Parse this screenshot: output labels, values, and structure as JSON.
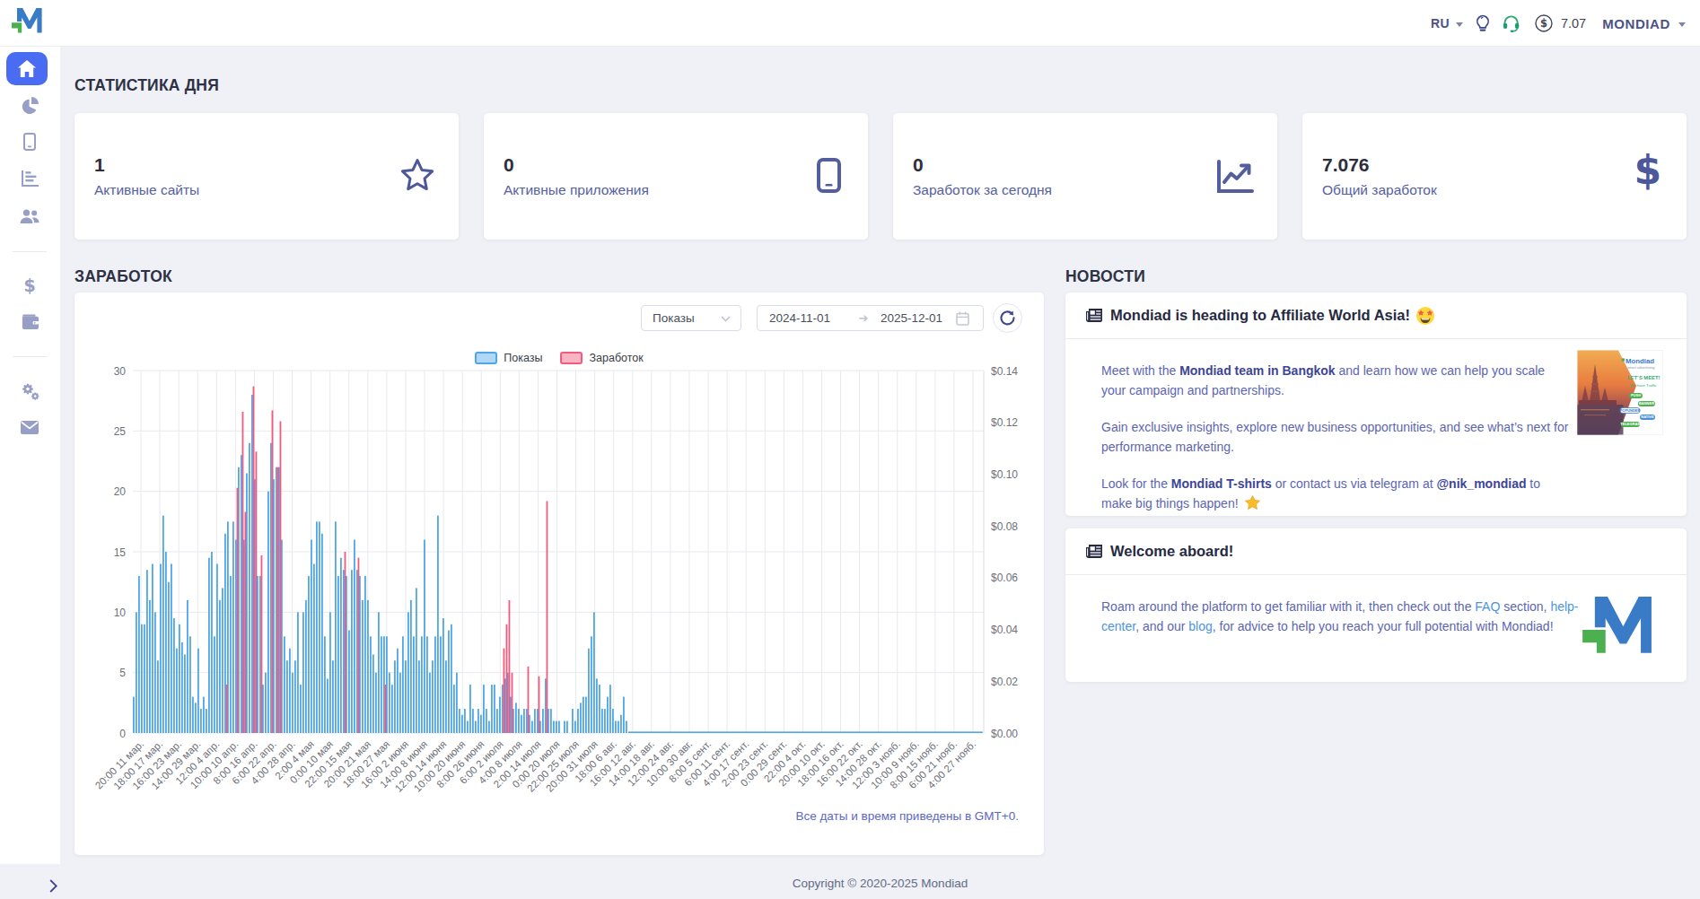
{
  "header": {
    "brand": "Mondiad",
    "lang": "RU",
    "balance": "7.07",
    "account": "MONDIAD"
  },
  "sidebar": {
    "items": [
      {
        "icon": "home",
        "active": true
      },
      {
        "icon": "pie-chart",
        "active": false
      },
      {
        "icon": "mobile",
        "active": false
      },
      {
        "icon": "bar-chart",
        "active": false
      },
      {
        "icon": "users",
        "active": false
      },
      {
        "icon": "dollar",
        "active": false
      },
      {
        "icon": "wallet",
        "active": false
      },
      {
        "icon": "gears",
        "active": false
      },
      {
        "icon": "envelope",
        "active": false
      }
    ]
  },
  "stats": {
    "title": "СТАТИСТИКА ДНЯ",
    "cards": [
      {
        "value": "1",
        "label": "Активные сайты",
        "icon": "star"
      },
      {
        "value": "0",
        "label": "Активные приложения",
        "icon": "mobile"
      },
      {
        "value": "0",
        "label": "Заработок за сегодня",
        "icon": "chart-line"
      },
      {
        "value": "7.076",
        "label": "Общий заработок",
        "icon": "dollar"
      }
    ]
  },
  "earnings": {
    "title": "ЗАРАБОТОК",
    "metric_select": "Показы",
    "date_from": "2024-11-01",
    "date_to": "2025-12-01",
    "gmt_note": "Все даты и время приведены в GMT+0."
  },
  "chart_data": {
    "type": "bar",
    "title": "",
    "x_labels": [
      "20:00 11 мар.",
      "18:00 17 мар.",
      "16:00 23 мар.",
      "14:00 29 мар.",
      "12:00 4 апр.",
      "10:00 10 апр.",
      "8:00 16 апр.",
      "6:00 22 апр.",
      "4:00 28 апр.",
      "2:00 4 мая",
      "0:00 10 мая",
      "22:00 15 мая",
      "20:00 21 мая",
      "18:00 27 мая",
      "16:00 2 июня",
      "14:00 8 июня",
      "12:00 14 июня",
      "10:00 20 июня",
      "8:00 26 июня",
      "6:00 2 июля",
      "4:00 8 июля",
      "2:00 14 июля",
      "0:00 20 июля",
      "22:00 25 июля",
      "20:00 31 июля",
      "18:00 6 авг.",
      "16:00 12 авг.",
      "14:00 18 авг.",
      "12:00 24 авг.",
      "10:00 30 авг.",
      "8:00 5 сент.",
      "6:00 11 сент.",
      "4:00 17 сент.",
      "2:00 23 сент.",
      "0:00 29 сент.",
      "22:00 4 окт.",
      "20:00 10 окт.",
      "18:00 16 окт.",
      "16:00 22 окт.",
      "14:00 28 окт.",
      "12:00 3 нояб.",
      "10:00 9 нояб.",
      "8:00 15 нояб.",
      "6:00 21 нояб.",
      "4:00 27 нояб."
    ],
    "left_axis": {
      "min": 0,
      "max": 30,
      "ticks": [
        0,
        5,
        10,
        15,
        20,
        25,
        30
      ]
    },
    "right_axis": {
      "min": 0,
      "max": 0.14,
      "step": 0.02,
      "prefix": "$"
    },
    "grid": true,
    "legend_position": "top-center",
    "series": [
      {
        "name": "Показы",
        "axis": "left",
        "color": "#4FA6E9",
        "values": [
          3,
          10,
          13,
          9,
          9,
          13.5,
          11,
          14,
          10,
          6,
          14,
          18,
          15,
          12.5,
          14,
          9.5,
          7,
          9,
          7.5,
          6.5,
          11,
          8,
          3,
          2.5,
          7,
          2,
          3,
          2,
          14.5,
          15,
          8,
          14,
          11,
          12,
          16.5,
          17.5,
          13,
          17.5,
          16,
          22,
          23,
          16,
          21.5,
          24,
          28,
          21,
          13,
          13,
          4,
          5,
          20,
          24,
          21,
          22,
          22,
          16,
          8,
          6,
          7,
          5,
          6,
          10,
          4,
          10,
          11,
          13,
          16,
          14,
          17.5,
          17.5,
          16.5,
          8,
          4.5,
          10,
          6,
          17.5,
          13,
          14.5,
          13.5,
          13,
          8.5,
          13.5,
          16,
          13.5,
          13,
          11,
          13,
          11,
          8,
          6.5,
          5,
          10,
          8,
          8,
          8,
          5,
          4,
          6,
          7,
          5,
          8,
          6,
          10,
          11,
          8,
          12,
          6,
          8,
          16,
          8,
          5,
          6,
          8,
          18,
          8,
          9.5,
          6,
          8.5,
          9,
          4,
          5,
          2,
          1.5,
          2,
          1,
          4,
          2,
          1,
          2,
          1.5,
          4,
          2,
          1,
          4,
          4,
          2,
          3,
          4,
          4.5,
          5,
          3,
          2,
          2.5,
          2,
          1.5,
          2,
          2,
          1.5,
          1,
          2,
          2,
          1,
          2,
          4.5,
          2,
          2,
          1,
          1,
          1,
          null,
          1,
          1,
          null,
          2,
          1,
          2,
          2.5,
          3,
          3,
          7,
          8,
          10,
          4.5,
          4,
          2,
          2,
          3,
          4,
          2,
          1,
          1,
          1.5,
          3,
          1,
          0,
          0,
          0,
          0,
          0,
          0,
          0,
          0,
          0,
          0,
          0,
          0,
          0,
          0,
          0,
          0,
          0,
          0,
          0,
          0,
          0,
          0,
          0,
          0,
          0,
          0,
          0,
          0,
          0,
          0,
          0,
          0,
          0,
          0,
          0,
          0,
          0,
          0,
          0,
          0,
          0,
          0,
          0,
          0,
          0,
          0,
          0,
          0,
          0,
          0,
          0,
          0,
          0,
          0,
          0,
          0,
          0,
          0,
          0,
          0,
          0,
          0,
          0,
          0,
          0,
          0,
          0,
          0,
          0,
          0,
          0,
          0,
          0,
          0,
          0,
          0,
          0,
          0,
          0,
          0,
          0,
          0,
          0,
          0,
          0,
          0,
          0,
          0,
          0,
          0,
          0,
          0,
          0,
          0,
          0,
          0,
          0,
          0,
          0,
          0,
          0,
          0,
          0,
          0,
          0,
          0,
          0,
          0,
          0,
          0,
          0,
          0,
          0,
          0,
          0,
          0,
          0,
          0,
          0,
          0,
          0,
          0,
          0,
          0,
          0,
          0,
          0,
          0,
          0,
          0,
          0,
          0
        ]
      },
      {
        "name": "Заработок",
        "axis": "right",
        "color": "#F45A7D",
        "values": [
          0,
          0,
          0,
          0,
          0,
          0,
          0,
          0,
          0,
          0,
          0,
          0,
          0,
          0,
          0,
          0,
          0,
          0,
          0,
          0,
          0,
          0,
          0,
          0,
          0,
          0,
          0,
          0,
          0,
          0,
          0,
          0,
          0,
          0,
          0.0187,
          0,
          0,
          0,
          0.0947,
          0,
          0.1241,
          0.0854,
          0,
          0,
          0.1339,
          0.1087,
          0,
          0.0686,
          0,
          0,
          0,
          0.1246,
          0,
          0.1027,
          0.1204,
          0,
          0,
          0,
          0,
          0,
          0,
          0,
          0,
          0,
          0,
          0,
          0,
          0,
          0,
          0,
          0,
          0,
          0,
          0,
          0,
          0,
          0,
          0,
          0.07,
          0,
          0,
          0,
          0,
          0.0677,
          0,
          0,
          0,
          0,
          0,
          0,
          0,
          0,
          0,
          0.0187,
          0,
          0,
          0,
          0,
          0,
          0,
          0,
          0,
          0,
          0,
          0,
          0,
          0,
          0,
          0,
          0,
          0,
          0,
          0,
          0,
          0,
          0,
          0,
          0,
          0,
          0,
          0,
          0,
          0,
          0,
          0,
          0,
          0,
          0,
          0,
          0,
          0,
          0,
          0,
          0,
          0,
          0,
          0,
          0.0327,
          0.042,
          0.0513,
          0.0233,
          0,
          0,
          0,
          0,
          0,
          0.0257,
          0,
          0,
          0,
          0.0219,
          0,
          0,
          0.0896,
          0,
          0,
          0,
          0,
          0,
          0,
          0,
          0,
          0,
          0,
          0,
          0,
          0,
          0,
          0,
          0,
          0,
          0,
          0,
          0,
          0,
          0,
          0,
          0,
          0,
          0,
          0,
          0,
          0,
          0,
          0,
          0,
          0,
          0,
          0,
          0,
          0,
          0,
          0,
          0,
          0,
          0,
          0,
          0,
          0,
          0,
          0,
          0,
          0,
          0,
          0,
          0,
          0,
          0,
          0,
          0,
          0,
          0,
          0,
          0,
          0,
          0,
          0,
          0,
          0,
          0,
          0,
          0,
          0,
          0,
          0,
          0,
          0,
          0,
          0,
          0,
          0,
          0,
          0,
          0,
          0,
          0,
          0,
          0,
          0,
          0,
          0,
          0,
          0,
          0,
          0,
          0,
          0,
          0,
          0,
          0,
          0,
          0,
          0,
          0,
          0,
          0,
          0,
          0,
          0,
          0,
          0,
          0,
          0,
          0,
          0,
          0,
          0,
          0,
          0,
          0,
          0,
          0,
          0,
          0,
          0,
          0,
          0,
          0,
          0,
          0,
          0,
          0,
          0,
          0,
          0,
          0,
          0,
          0,
          0,
          0,
          0,
          0,
          0,
          0,
          0,
          0,
          0,
          0,
          0,
          0,
          0,
          0,
          0,
          0,
          0,
          0,
          0,
          0,
          0,
          0,
          0,
          0,
          0,
          0,
          0,
          0
        ]
      }
    ]
  },
  "news": {
    "title": "НОВОСТИ",
    "cards": [
      {
        "heading": "Mondiad is heading to Affiliate World Asia!",
        "emoji": "star-struck",
        "p1": [
          "Meet with the ",
          "Mondiad team in Bangkok",
          " and learn how we can help you scale your campaign and partnerships."
        ],
        "p2": "Gain exclusive insights, explore new business opportunities, and see what’s next for performance marketing.",
        "p3": [
          "Look for the ",
          "Mondiad T-shirts",
          " or contact us via telegram at ",
          "@nik_mondiad",
          " to make big things happen!"
        ],
        "promo": {
          "brand": "Mondiad",
          "tagline": "smart advertising",
          "line1": "LET`S MEET!",
          "line2": "We have Traffic",
          "tags": [
            "PUSH",
            "BANNER",
            "POPUNDER",
            "NATIVE",
            "TELEGRAM"
          ]
        }
      },
      {
        "heading": "Welcome aboard!",
        "p1": [
          "Roam around the platform to get familiar with it, then check out the ",
          "FAQ",
          " section, ",
          "help-center",
          ", and our ",
          "blog",
          ", for advice to help you reach your full potential with Mondiad!"
        ]
      }
    ]
  },
  "footer": {
    "copyright": "Copyright © 2020-2025 Mondiad"
  }
}
